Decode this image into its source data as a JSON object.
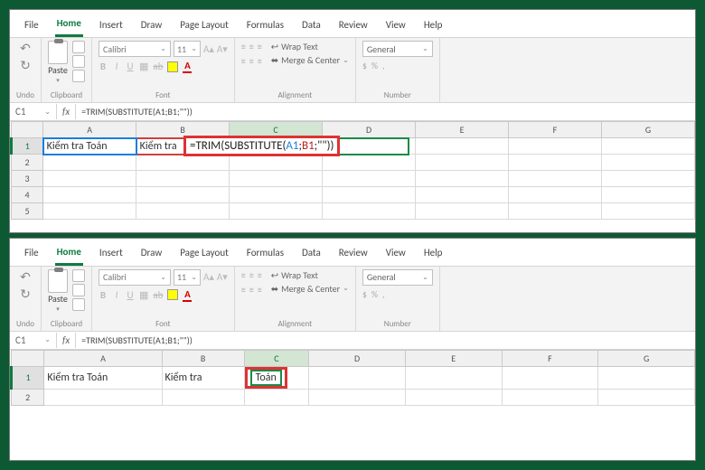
{
  "tabs": {
    "file": "File",
    "home": "Home",
    "insert": "Insert",
    "draw": "Draw",
    "pageLayout": "Page Layout",
    "formulas": "Formulas",
    "data": "Data",
    "review": "Review",
    "view": "View",
    "help": "Help"
  },
  "groups": {
    "undo": "Undo",
    "clipboard": "Clipboard",
    "font": "Font",
    "alignment": "Alignment",
    "number": "Number"
  },
  "clipboard": {
    "paste": "Paste"
  },
  "font": {
    "name": "Calibri",
    "size": "11",
    "bold": "B",
    "italic": "I",
    "underline": "U",
    "strike": "ab"
  },
  "align": {
    "wrap": "Wrap Text",
    "merge": "Merge & Center"
  },
  "number": {
    "format": "General",
    "dollar": "$",
    "percent": "%",
    "comma": ","
  },
  "top": {
    "namebox": "C1",
    "formula": "=TRIM(SUBSTITUTE(A1;B1;\"\"))",
    "cells": {
      "A1": "Kiểm tra Toán",
      "B1": "Kiểm tra",
      "formula_prefix": "=TRIM(SUBSTITUTE(",
      "formula_a": "A1",
      "formula_sep1": ";",
      "formula_b": "B1",
      "formula_suffix": ";\"\"))"
    },
    "cols": [
      "A",
      "B",
      "C",
      "D",
      "E",
      "F",
      "G"
    ],
    "rows": [
      "1",
      "2",
      "3",
      "4",
      "5"
    ]
  },
  "bottom": {
    "namebox": "C1",
    "formula": "=TRIM(SUBSTITUTE(A1;B1;\"\"))",
    "cells": {
      "A1": "Kiểm tra Toán",
      "B1": "Kiểm tra",
      "C1": "Toán"
    },
    "cols": [
      "A",
      "B",
      "C",
      "D",
      "E",
      "F",
      "G"
    ],
    "rows": [
      "1",
      "2"
    ]
  }
}
